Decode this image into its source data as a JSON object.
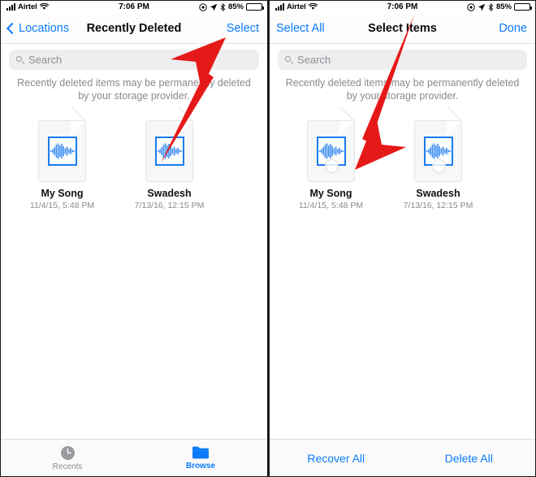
{
  "status_bar": {
    "carrier": "Airtel",
    "time": "7:06 PM",
    "battery_percent": "85%",
    "icons": [
      "signal-bars-icon",
      "wifi-icon",
      "alarm-icon",
      "location-arrow-icon",
      "bluetooth-icon",
      "battery-icon"
    ]
  },
  "colors": {
    "accent_blue": "#0b7bfb",
    "icon_blue": "#1a7bf0",
    "arrow_red": "#e61919",
    "secondary_text": "#8a8a8e",
    "search_bg": "#eeeef0"
  },
  "left_panel": {
    "nav": {
      "back_label": "Locations",
      "title": "Recently Deleted",
      "action_label": "Select"
    },
    "search": {
      "placeholder": "Search"
    },
    "note": "Recently deleted items may be permanently deleted by your storage provider.",
    "files": [
      {
        "name": "My Song",
        "date": "11/4/15, 5:48 PM",
        "icon": "audio-waveform-icon"
      },
      {
        "name": "Swadesh",
        "date": "7/13/16, 12:15 PM",
        "icon": "audio-waveform-icon"
      }
    ],
    "tabs": [
      {
        "label": "Recents",
        "icon": "clock-icon",
        "active": false
      },
      {
        "label": "Browse",
        "icon": "folder-icon",
        "active": true
      }
    ]
  },
  "right_panel": {
    "nav": {
      "select_all_label": "Select All",
      "title": "Select Items",
      "done_label": "Done"
    },
    "search": {
      "placeholder": "Search"
    },
    "note": "Recently deleted items may be permanently deleted by your storage provider.",
    "files": [
      {
        "name": "My Song",
        "date": "11/4/15, 5:48 PM",
        "icon": "audio-waveform-icon",
        "selected": false
      },
      {
        "name": "Swadesh",
        "date": "7/13/16, 12:15 PM",
        "icon": "audio-waveform-icon",
        "selected": false
      }
    ],
    "actions": [
      {
        "label": "Recover All"
      },
      {
        "label": "Delete All"
      }
    ]
  },
  "annotations": [
    {
      "name": "arrow-to-select",
      "target": "Select",
      "direction": "up-right"
    },
    {
      "name": "arrow-to-recover-all",
      "target": "Recover All",
      "direction": "down-left"
    }
  ]
}
